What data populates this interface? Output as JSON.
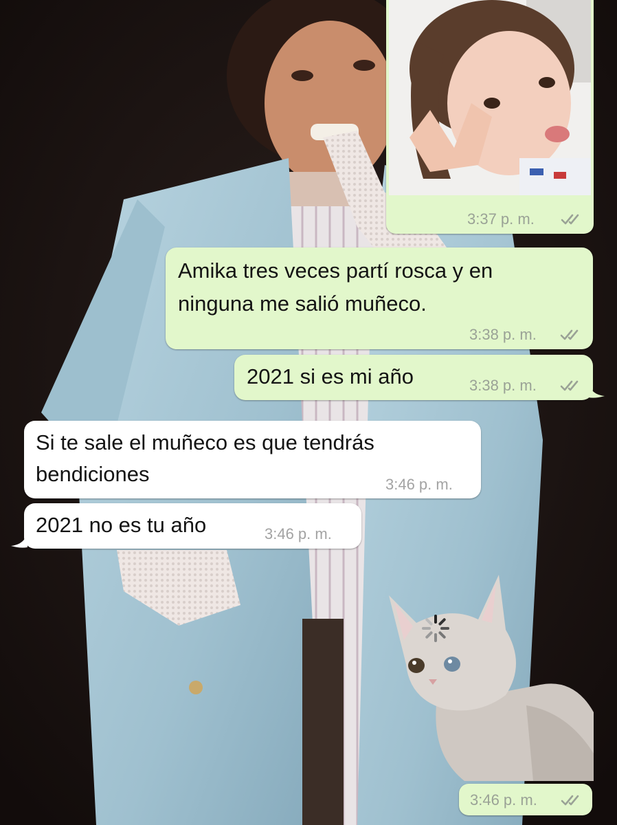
{
  "chat": {
    "messages": [
      {
        "id": "m1",
        "direction": "outgoing",
        "type": "photo",
        "time": "3:37 p. m.",
        "status": "read-double-check-icon"
      },
      {
        "id": "m2",
        "direction": "outgoing",
        "type": "text",
        "lines": [
          "Amika tres veces partí rosca y en",
          "ninguna me salió muñeco."
        ],
        "time": "3:38 p. m.",
        "status": "read-double-check-icon"
      },
      {
        "id": "m3",
        "direction": "outgoing",
        "type": "text",
        "lines": [
          "2021 si es mi año"
        ],
        "time": "3:38 p. m.",
        "status": "read-double-check-icon"
      },
      {
        "id": "m4",
        "direction": "incoming",
        "type": "text",
        "lines": [
          "Si te sale el muñeco es que tendrás",
          "bendiciones"
        ],
        "time": "3:46 p. m."
      },
      {
        "id": "m5",
        "direction": "incoming",
        "type": "text",
        "lines": [
          "2021 no es tu año"
        ],
        "time": "3:46 p. m."
      },
      {
        "id": "m6",
        "direction": "outgoing",
        "type": "sticker",
        "sticker": "loading-cat-sticker",
        "time": "3:46 p. m.",
        "status": "read-double-check-icon"
      }
    ]
  },
  "colors": {
    "outgoing_bubble": "#e2f7cb",
    "incoming_bubble": "#ffffff",
    "timestamp": "#9aa296",
    "wallpaper_bg": "#1b1413",
    "jacket": "#a9c9d6"
  }
}
